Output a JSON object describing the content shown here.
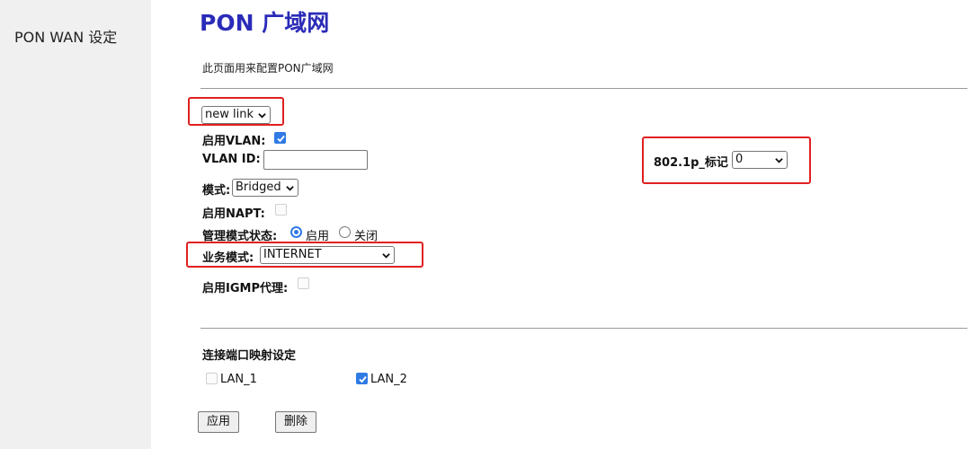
{
  "sidebar": {
    "items": [
      {
        "label": "PON WAN 设定"
      }
    ]
  },
  "page": {
    "title": "PON 广域网",
    "description": "此页面用来配置PON广域网"
  },
  "form": {
    "link_select": {
      "selected": "new link"
    },
    "enable_vlan": {
      "label": "启用VLAN:",
      "checked": true
    },
    "vlan_id": {
      "label": "VLAN ID:",
      "value": ""
    },
    "mode": {
      "label": "模式:",
      "selected": "Bridged"
    },
    "enable_napt": {
      "label": "启用NAPT:",
      "checked": false,
      "disabled": true
    },
    "admin_state": {
      "label": "管理模式状态:",
      "options": [
        {
          "label": "启用",
          "selected": true
        },
        {
          "label": "关闭",
          "selected": false
        }
      ]
    },
    "service_mode": {
      "label": "业务模式:",
      "selected": "INTERNET"
    },
    "enable_igmp": {
      "label": "启用IGMP代理:",
      "checked": false,
      "disabled": true
    },
    "dot1p": {
      "label": "802.1p_标记",
      "selected": "0"
    }
  },
  "port_mapping": {
    "title": "连接端口映射设定",
    "ports": [
      {
        "label": "LAN_1",
        "checked": false
      },
      {
        "label": "LAN_2",
        "checked": true
      }
    ]
  },
  "buttons": {
    "apply": "应用",
    "delete": "删除"
  },
  "colors": {
    "title": "#2b2bb8",
    "highlight": "#e02020",
    "accent": "#2f7ae5",
    "sidebar_bg": "#f0f0f0"
  }
}
